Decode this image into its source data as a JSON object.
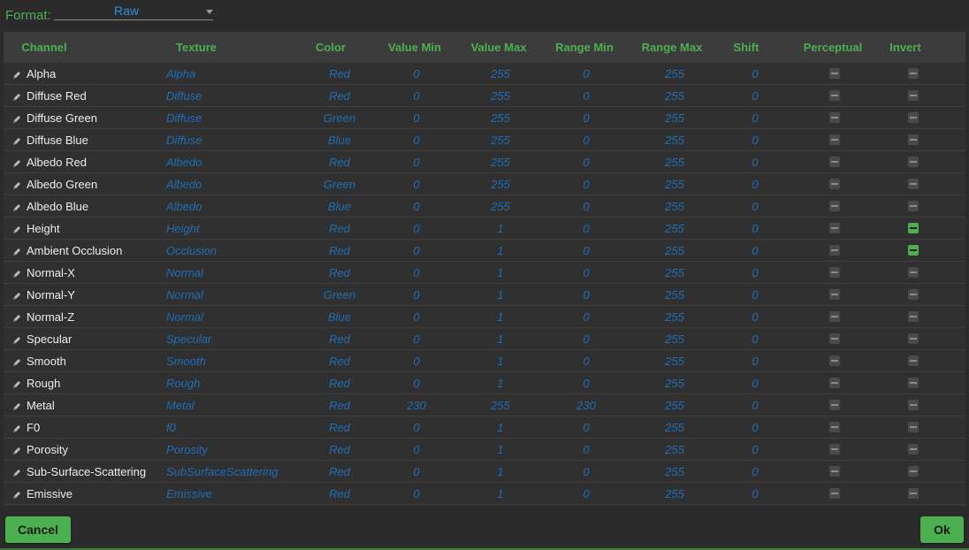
{
  "format": {
    "label": "Format:",
    "value": "Raw"
  },
  "columns": [
    "Channel",
    "Texture",
    "Color",
    "Value Min",
    "Value Max",
    "Range Min",
    "Range Max",
    "Shift",
    "Perceptual",
    "Invert"
  ],
  "rows": [
    {
      "channel": "Alpha",
      "texture": "Alpha",
      "color": "Red",
      "vmin": "0",
      "vmax": "255",
      "rmin": "0",
      "rmax": "255",
      "shift": "0",
      "perceptual": false,
      "invert": false
    },
    {
      "channel": "Diffuse Red",
      "texture": "Diffuse",
      "color": "Red",
      "vmin": "0",
      "vmax": "255",
      "rmin": "0",
      "rmax": "255",
      "shift": "0",
      "perceptual": false,
      "invert": false
    },
    {
      "channel": "Diffuse Green",
      "texture": "Diffuse",
      "color": "Green",
      "vmin": "0",
      "vmax": "255",
      "rmin": "0",
      "rmax": "255",
      "shift": "0",
      "perceptual": false,
      "invert": false
    },
    {
      "channel": "Diffuse Blue",
      "texture": "Diffuse",
      "color": "Blue",
      "vmin": "0",
      "vmax": "255",
      "rmin": "0",
      "rmax": "255",
      "shift": "0",
      "perceptual": false,
      "invert": false
    },
    {
      "channel": "Albedo Red",
      "texture": "Albedo",
      "color": "Red",
      "vmin": "0",
      "vmax": "255",
      "rmin": "0",
      "rmax": "255",
      "shift": "0",
      "perceptual": false,
      "invert": false
    },
    {
      "channel": "Albedo Green",
      "texture": "Albedo",
      "color": "Green",
      "vmin": "0",
      "vmax": "255",
      "rmin": "0",
      "rmax": "255",
      "shift": "0",
      "perceptual": false,
      "invert": false
    },
    {
      "channel": "Albedo Blue",
      "texture": "Albedo",
      "color": "Blue",
      "vmin": "0",
      "vmax": "255",
      "rmin": "0",
      "rmax": "255",
      "shift": "0",
      "perceptual": false,
      "invert": false
    },
    {
      "channel": "Height",
      "texture": "Height",
      "color": "Red",
      "vmin": "0",
      "vmax": "1",
      "rmin": "0",
      "rmax": "255",
      "shift": "0",
      "perceptual": false,
      "invert": true
    },
    {
      "channel": "Ambient Occlusion",
      "texture": "Occlusion",
      "color": "Red",
      "vmin": "0",
      "vmax": "1",
      "rmin": "0",
      "rmax": "255",
      "shift": "0",
      "perceptual": false,
      "invert": true
    },
    {
      "channel": "Normal-X",
      "texture": "Normal",
      "color": "Red",
      "vmin": "0",
      "vmax": "1",
      "rmin": "0",
      "rmax": "255",
      "shift": "0",
      "perceptual": false,
      "invert": false
    },
    {
      "channel": "Normal-Y",
      "texture": "Normal",
      "color": "Green",
      "vmin": "0",
      "vmax": "1",
      "rmin": "0",
      "rmax": "255",
      "shift": "0",
      "perceptual": false,
      "invert": false
    },
    {
      "channel": "Normal-Z",
      "texture": "Normal",
      "color": "Blue",
      "vmin": "0",
      "vmax": "1",
      "rmin": "0",
      "rmax": "255",
      "shift": "0",
      "perceptual": false,
      "invert": false
    },
    {
      "channel": "Specular",
      "texture": "Specular",
      "color": "Red",
      "vmin": "0",
      "vmax": "1",
      "rmin": "0",
      "rmax": "255",
      "shift": "0",
      "perceptual": false,
      "invert": false
    },
    {
      "channel": "Smooth",
      "texture": "Smooth",
      "color": "Red",
      "vmin": "0",
      "vmax": "1",
      "rmin": "0",
      "rmax": "255",
      "shift": "0",
      "perceptual": false,
      "invert": false
    },
    {
      "channel": "Rough",
      "texture": "Rough",
      "color": "Red",
      "vmin": "0",
      "vmax": "1",
      "rmin": "0",
      "rmax": "255",
      "shift": "0",
      "perceptual": false,
      "invert": false
    },
    {
      "channel": "Metal",
      "texture": "Metal",
      "color": "Red",
      "vmin": "230",
      "vmax": "255",
      "rmin": "230",
      "rmax": "255",
      "shift": "0",
      "perceptual": false,
      "invert": false
    },
    {
      "channel": "F0",
      "texture": "f0",
      "color": "Red",
      "vmin": "0",
      "vmax": "1",
      "rmin": "0",
      "rmax": "255",
      "shift": "0",
      "perceptual": false,
      "invert": false
    },
    {
      "channel": "Porosity",
      "texture": "Porosity",
      "color": "Red",
      "vmin": "0",
      "vmax": "1",
      "rmin": "0",
      "rmax": "255",
      "shift": "0",
      "perceptual": false,
      "invert": false
    },
    {
      "channel": "Sub-Surface-Scattering",
      "texture": "SubSurfaceScattering",
      "color": "Red",
      "vmin": "0",
      "vmax": "1",
      "rmin": "0",
      "rmax": "255",
      "shift": "0",
      "perceptual": false,
      "invert": false
    },
    {
      "channel": "Emissive",
      "texture": "Emissive",
      "color": "Red",
      "vmin": "0",
      "vmax": "1",
      "rmin": "0",
      "rmax": "255",
      "shift": "0",
      "perceptual": false,
      "invert": false
    }
  ],
  "buttons": {
    "cancel": "Cancel",
    "ok": "Ok"
  },
  "icons": {
    "row_icon": "pencil-icon",
    "dropdown": "chevron-down-icon"
  },
  "colors": {
    "accent": "#4caf50",
    "value_text": "#1f6fb8"
  }
}
